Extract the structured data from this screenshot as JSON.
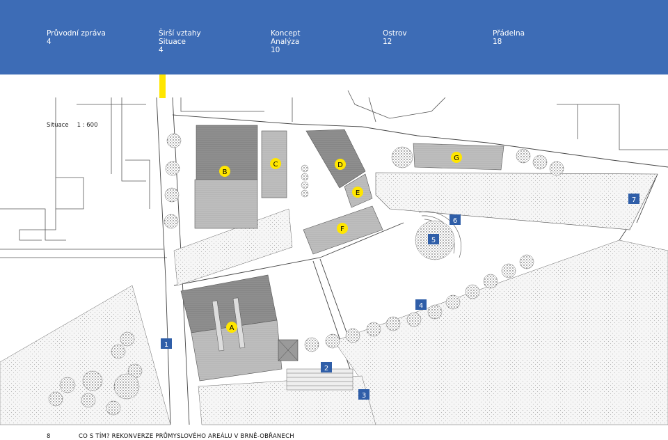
{
  "nav": [
    {
      "title": "Průvodní zpráva",
      "lines": [
        "4"
      ]
    },
    {
      "title": "Širší vztahy",
      "lines": [
        "Situace",
        "4"
      ]
    },
    {
      "title": "Koncept",
      "lines": [
        "Analýza",
        "10"
      ]
    },
    {
      "title": "Ostrov",
      "lines": [
        "12"
      ]
    },
    {
      "title": "Přádelna",
      "lines": [
        "18"
      ]
    }
  ],
  "situation": {
    "label": "Situace",
    "scale": "1 : 600"
  },
  "buildings": [
    "A",
    "B",
    "C",
    "D",
    "E",
    "F",
    "G"
  ],
  "spots": [
    "1",
    "2",
    "3",
    "4",
    "5",
    "6",
    "7"
  ],
  "footer": {
    "page_number": "8",
    "title": "CO S TÍM? REKONVERZE PRŮMYSLOVÉHO AREÁLU V BRNĚ-OBŘANECH"
  },
  "colors": {
    "nav_bg": "#3d6cb6",
    "accent_yellow": "#ffe600",
    "building_label_bg": "#ffe600",
    "spot_label_bg": "#2f5ea8"
  }
}
